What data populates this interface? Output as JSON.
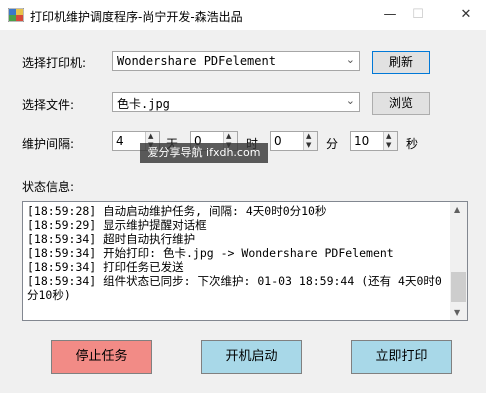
{
  "window": {
    "title": "打印机维护调度程序-尚宁开发-森浩出品",
    "minimize_glyph": "—",
    "maximize_glyph": "☐",
    "close_glyph": "✕"
  },
  "printer": {
    "label": "选择打印机:",
    "selected": "Wondershare PDFelement",
    "refresh_label": "刷新"
  },
  "file": {
    "label": "选择文件:",
    "selected": "色卡.jpg",
    "browse_label": "浏览"
  },
  "interval": {
    "label": "维护间隔:",
    "days": "4",
    "days_unit": "天",
    "hours": "0",
    "hours_unit": "时",
    "minutes": "0",
    "minutes_unit": "分",
    "seconds": "10",
    "seconds_unit": "秒"
  },
  "overlay_text": "爱分享导航 ifxdh.com",
  "status": {
    "label": "状态信息:",
    "lines": [
      "[18:59:28] 自动启动维护任务, 间隔: 4天0时0分10秒",
      "[18:59:29] 显示维护提醒对话框",
      "[18:59:34] 超时自动执行维护",
      "[18:59:34] 开始打印: 色卡.jpg -> Wondershare PDFelement",
      "[18:59:34] 打印任务已发送",
      "[18:59:34] 组件状态已同步: 下次维护: 01-03 18:59:44 (还有 4天0时0分10秒)"
    ]
  },
  "actions": {
    "stop_label": "停止任务",
    "startup_label": "开机启动",
    "print_now_label": "立即打印"
  },
  "colors": {
    "stop": "#f28b86",
    "startup": "#a8d8e8",
    "print_now": "#a8d8e8"
  },
  "icons": {
    "app": "app-icon",
    "dropdown": "chevron-down-icon",
    "spin_up": "spin-up-icon",
    "spin_down": "spin-down-icon"
  }
}
